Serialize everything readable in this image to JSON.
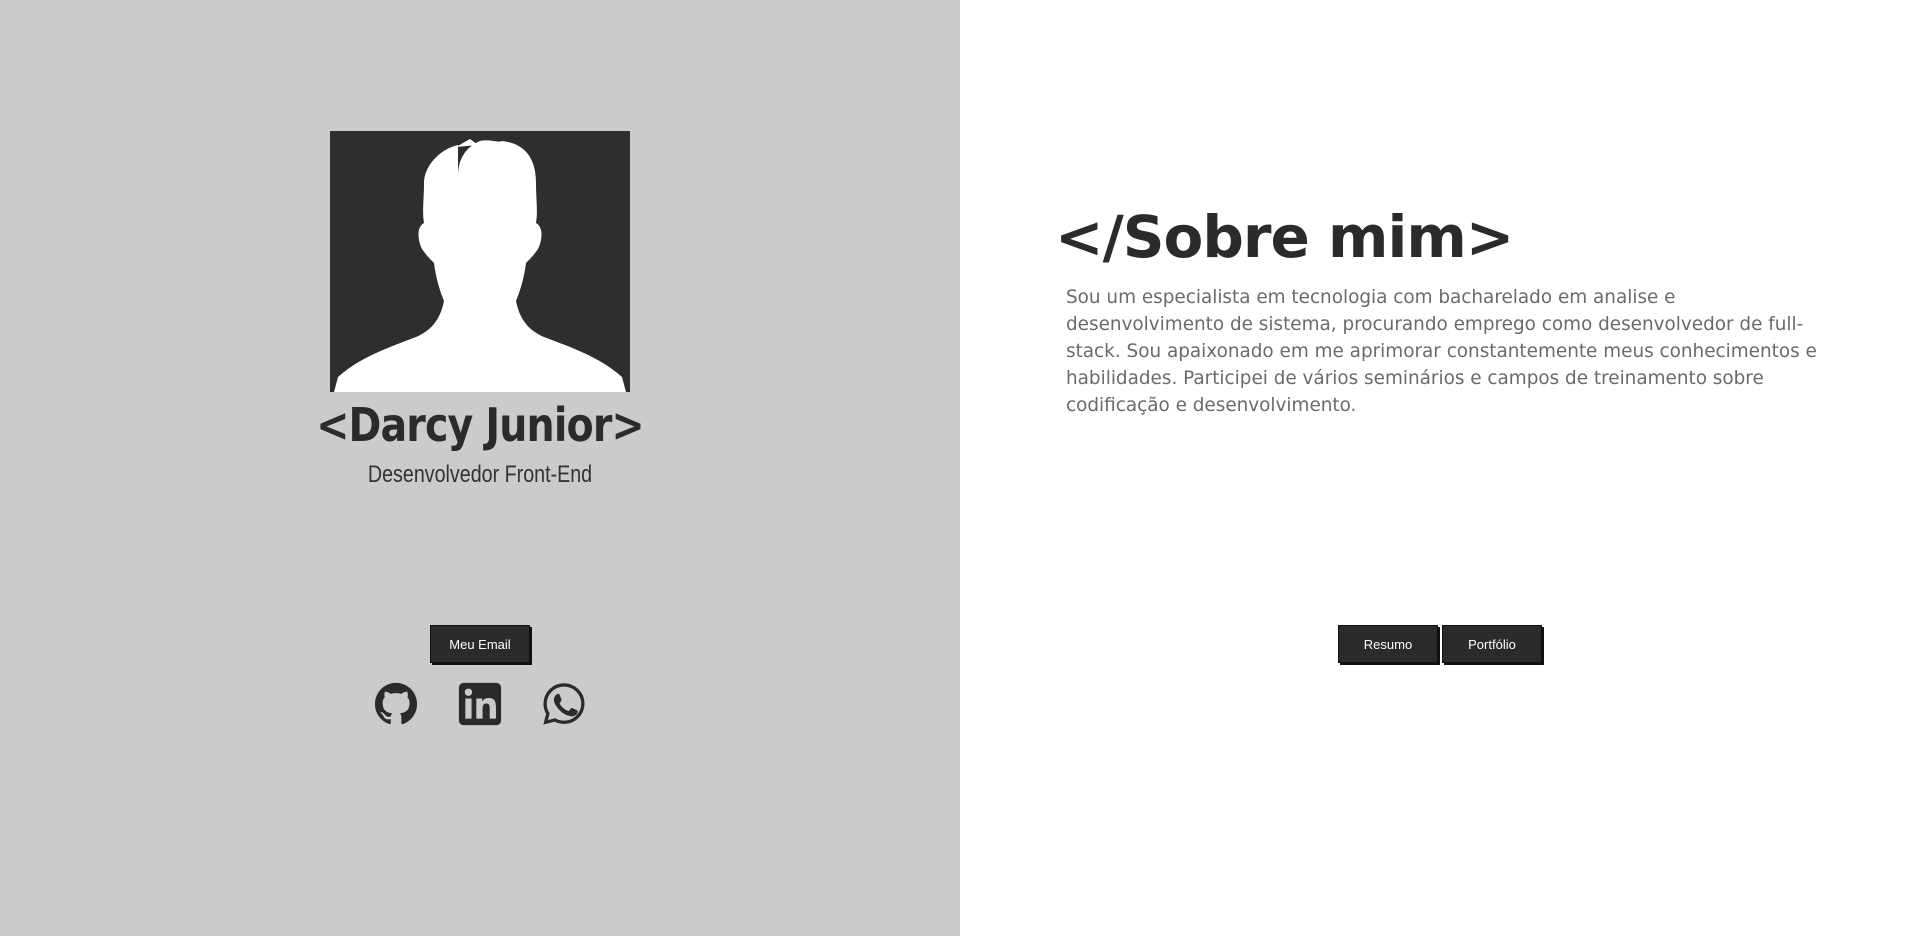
{
  "profile": {
    "name": "<Darcy Junior>",
    "role": "Desenvolvedor Front-End",
    "email_button": "Meu Email",
    "avatar_icon": "user-silhouette-icon"
  },
  "social": [
    {
      "name": "github-icon"
    },
    {
      "name": "linkedin-icon"
    },
    {
      "name": "whatsapp-icon"
    }
  ],
  "about": {
    "title": "</Sobre mim>",
    "text": "Sou um especialista em tecnologia com bacharelado em analise e desenvolvimento de sistema, procurando emprego como desenvolvedor de full-stack. Sou apaixonado em me aprimorar constantemente meus conhecimentos e habilidades. Participei de vários seminários e campos de treinamento sobre codificação e desenvolvimento.",
    "buttons": {
      "resume": "Resumo",
      "portfolio": "Portfólio"
    }
  },
  "colors": {
    "left_bg": "#cbcbcb",
    "right_bg": "#ffffff",
    "dark": "#2b2b2b",
    "text_gray": "#6a6a6a"
  }
}
